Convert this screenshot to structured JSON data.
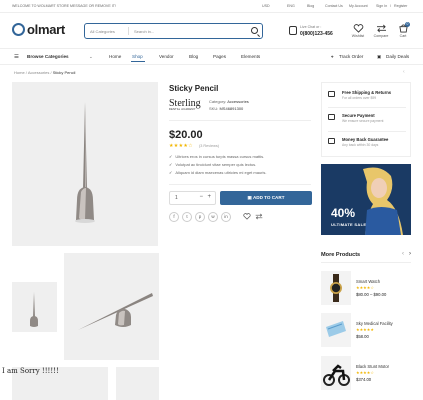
{
  "topbar": {
    "welcome": "WELCOME TO WOLMART STORE MESSAGE OR REMOVE IT!",
    "currency": "USD",
    "language": "ENG",
    "links": [
      "Blog",
      "Contact Us",
      "My Account",
      "Sign In",
      "/",
      "Register"
    ]
  },
  "header": {
    "logo": "olmart",
    "search_category": "All Categories",
    "search_placeholder": "Search in...",
    "chat_label": "Live Chat or :",
    "phone": "0(800)123-456",
    "icons": [
      {
        "label": "Wishlist",
        "icon": "heart-icon"
      },
      {
        "label": "Compare",
        "icon": "compare-icon"
      },
      {
        "label": "Cart",
        "icon": "cart-icon",
        "count": "0"
      }
    ]
  },
  "nav": {
    "browse": "Browse Categories",
    "items": [
      "Home",
      "Shop",
      "Vendor",
      "Blog",
      "Pages",
      "Elements"
    ],
    "track_order": "Track Order",
    "daily_deals": "Daily Deals"
  },
  "breadcrumb": [
    "Home",
    "Accessories",
    "Sticky Pencil"
  ],
  "product": {
    "title": "Sticky Pencil",
    "brand_logo": "Sterling",
    "brand_tagline": "DENTAL ACADEMY",
    "category_label": "Category:",
    "category": "Accessories",
    "sku_label": "SKU:",
    "sku": "MS46891300",
    "price": "$20.00",
    "stars": "★★★★☆",
    "reviews": "(3 Reviews)",
    "bullets": [
      "Ultrices eros in cursus turpis massa cursus mattis.",
      "Volutpat ac tincidunt vitae semper quis lectus.",
      "Aliquam id diam maecenas ultricies mi eget mauris."
    ],
    "qty": "1",
    "add_to_cart": "ADD TO CART",
    "social": [
      "f",
      "t",
      "p",
      "w",
      "in"
    ]
  },
  "features": [
    {
      "title": "Free Shipping & Returns",
      "desc": "For all orders over $99"
    },
    {
      "title": "Secure Payment",
      "desc": "We ensure secure payment"
    },
    {
      "title": "Money Back Guarantee",
      "desc": "Any back within 30 days"
    }
  ],
  "banner": {
    "big": "40%",
    "small": "ULTIMATE SALE"
  },
  "more_products": {
    "title": "More Products",
    "items": [
      {
        "name": "Smart Watch",
        "stars": "★★★★☆",
        "price": "$80.00 – $90.00"
      },
      {
        "name": "Sky Medical Facility",
        "stars": "★★★★★",
        "price": "$58.00"
      },
      {
        "name": "Black Stunt Motor",
        "stars": "★★★★☆",
        "price": "$374.00"
      }
    ]
  },
  "overlay_text": "I am Sorry !!!!!!"
}
